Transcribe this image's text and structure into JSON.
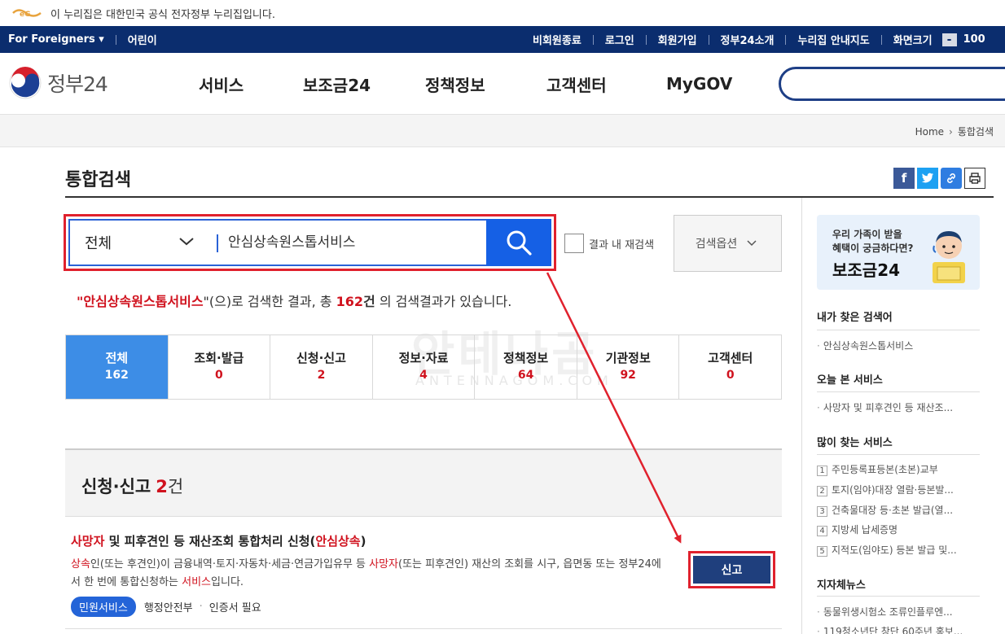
{
  "gov_banner": {
    "text": "이 누리집은 대한민국 공식 전자정부 누리집입니다."
  },
  "util_bar": {
    "for_foreigners": "For Foreigners",
    "kids": "어린이",
    "links": [
      "비회원종료",
      "로그인",
      "회원가입",
      "정부24소개",
      "누리집 안내지도",
      "화면크기"
    ],
    "zoom_minus": "-",
    "zoom_value": "100"
  },
  "header": {
    "logo_text": "정부24",
    "nav": [
      "서비스",
      "보조금24",
      "정책정보",
      "고객센터",
      "MyGOV"
    ]
  },
  "breadcrumb": {
    "home": "Home",
    "current": "통합검색"
  },
  "page": {
    "title": "통합검색"
  },
  "search": {
    "scope": "전체",
    "query": "안심상속원스톱서비스",
    "re_search_label": "결과 내 재검색",
    "options_label": "검색옵션"
  },
  "summary": {
    "quote_open": "\"",
    "keyword": "안심상속원스톱서비스",
    "quote_close": "\"",
    "mid": "(으)로 검색한 결과, 총 ",
    "total": "162",
    "unit": "건",
    "tail": " 의 검색결과가 있습니다."
  },
  "tabs": [
    {
      "label": "전체",
      "count": "162"
    },
    {
      "label": "조회·발급",
      "count": "0"
    },
    {
      "label": "신청·신고",
      "count": "2"
    },
    {
      "label": "정보·자료",
      "count": "4"
    },
    {
      "label": "정책정보",
      "count": "64"
    },
    {
      "label": "기관정보",
      "count": "92"
    },
    {
      "label": "고객센터",
      "count": "0"
    }
  ],
  "section": {
    "title": "신청·신고",
    "count": "2",
    "unit": "건"
  },
  "result": {
    "title_a": "사망자",
    "title_b": " 및 피후견인 등 재산조회 통합처리 신청(",
    "title_c": "안심상속",
    "title_d": ")",
    "desc": [
      {
        "t": "상속",
        "h": true
      },
      {
        "t": "인(또는 후견인)이 금융내역·토지·자동차·세금·연금가입유무 등 ",
        "h": false
      },
      {
        "t": "사망자",
        "h": true
      },
      {
        "t": "(또는 피후견인) 재산의 조회를 시구, 읍면동 또는 정부24에서 한 번에 통합신청하는 ",
        "h": false
      },
      {
        "t": "서비스",
        "h": true
      },
      {
        "t": "입니다.",
        "h": false
      }
    ],
    "badge": "민원서비스",
    "agency": "행정안전부",
    "cert": "인증서 필요",
    "button": "신고"
  },
  "watermark": {
    "main": "안테나곰",
    "sub": "ANTENNAGOM.COM"
  },
  "sidebar": {
    "promo_line1": "우리 가족이 받을",
    "promo_line2": "혜택이 궁금하다면?",
    "promo_line3": "보조금24",
    "my_search_title": "내가 찾은 검색어",
    "my_search_items": [
      "안심상속원스톱서비스"
    ],
    "today_title": "오늘 본 서비스",
    "today_items": [
      "사망자 및 피후견인 등 재산조..."
    ],
    "popular_title": "많이 찾는 서비스",
    "popular_items": [
      "주민등록표등본(초본)교부",
      "토지(임야)대장 열람·등본발...",
      "건축물대장 등·초본 발급(열...",
      "지방세 납세증명",
      "지적도(임야도) 등본 발급 및..."
    ],
    "local_news_title": "지자체뉴스",
    "local_news_items": [
      "동물위생시험소 조류인플루엔...",
      "119청소년단 창단 60주년 홍보..."
    ]
  },
  "colors": {
    "nav_bar": "#0b2d6e",
    "accent_blue": "#1560e5",
    "highlight_red": "#d0121e",
    "annotation_red": "#e0212d"
  }
}
